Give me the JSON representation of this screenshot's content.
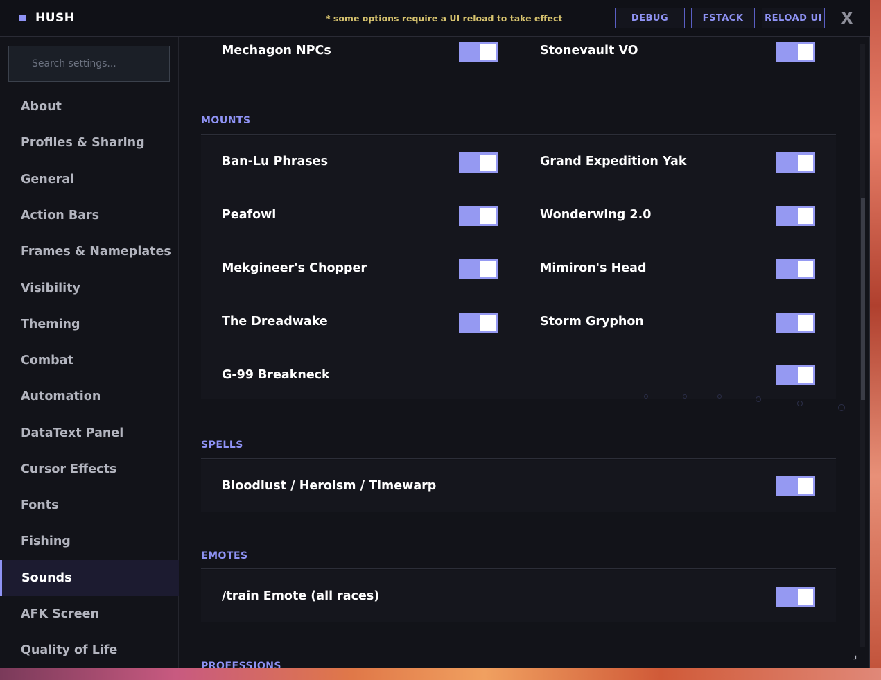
{
  "app": {
    "name": "HUSH",
    "notice": "* some options require a UI reload to take effect",
    "buttons": {
      "debug": "DEBUG",
      "fstack": "FSTACK",
      "reload": "RELOAD UI",
      "close": "X"
    }
  },
  "search": {
    "placeholder": "Search settings..."
  },
  "sidebar": {
    "items": [
      {
        "label": "About"
      },
      {
        "label": "Profiles & Sharing"
      },
      {
        "label": "General"
      },
      {
        "label": "Action Bars"
      },
      {
        "label": "Frames & Nameplates"
      },
      {
        "label": "Visibility"
      },
      {
        "label": "Theming"
      },
      {
        "label": "Combat"
      },
      {
        "label": "Automation"
      },
      {
        "label": "DataText Panel"
      },
      {
        "label": "Cursor Effects"
      },
      {
        "label": "Fonts"
      },
      {
        "label": "Fishing"
      },
      {
        "label": "Sounds",
        "active": true
      },
      {
        "label": "AFK Screen"
      },
      {
        "label": "Quality of Life"
      }
    ]
  },
  "content": {
    "top_row": {
      "left": "Mechagon NPCs",
      "right": "Stonevault VO",
      "left_on": true,
      "right_on": true
    },
    "sections": {
      "mounts": {
        "title": "MOUNTS",
        "items": [
          {
            "label": "Ban-Lu Phrases",
            "on": true
          },
          {
            "label": "Grand Expedition Yak",
            "on": true
          },
          {
            "label": "Peafowl",
            "on": true
          },
          {
            "label": "Wonderwing 2.0",
            "on": true
          },
          {
            "label": "Mekgineer's Chopper",
            "on": true
          },
          {
            "label": "Mimiron's Head",
            "on": true
          },
          {
            "label": "The Dreadwake",
            "on": true
          },
          {
            "label": "Storm Gryphon",
            "on": true
          },
          {
            "label": "G-99 Breakneck",
            "on": true
          }
        ]
      },
      "spells": {
        "title": "SPELLS",
        "items": [
          {
            "label": "Bloodlust / Heroism / Timewarp",
            "on": true
          }
        ]
      },
      "emotes": {
        "title": "EMOTES",
        "items": [
          {
            "label": "/train Emote (all races)",
            "on": true
          }
        ]
      },
      "professions": {
        "title": "PROFESSIONS"
      }
    }
  },
  "colors": {
    "accent": "#8f93f5",
    "notice": "#d6c26e",
    "background": "#121319",
    "active_nav": "#1c1b30"
  }
}
